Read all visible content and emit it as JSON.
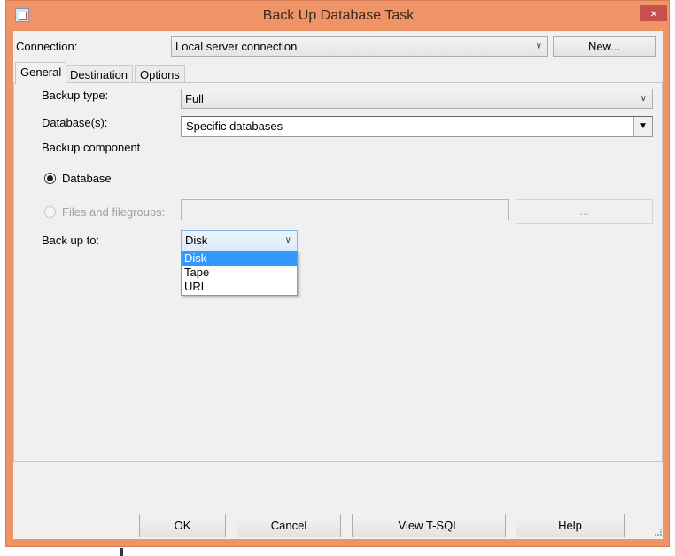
{
  "window": {
    "title": "Back Up Database Task",
    "close": "×"
  },
  "connection": {
    "label": "Connection:",
    "value": "Local server connection",
    "new_button": "New..."
  },
  "tabs": [
    {
      "label": "General",
      "active": true
    },
    {
      "label": "Destination"
    },
    {
      "label": "Options"
    }
  ],
  "general": {
    "backup_type": {
      "label": "Backup type:",
      "value": "Full"
    },
    "databases": {
      "label": "Database(s):",
      "value": "Specific databases"
    },
    "backup_component": {
      "label": "Backup component"
    },
    "radio_database": {
      "label": "Database",
      "checked": true
    },
    "radio_files": {
      "label": "Files and filegroups:",
      "enabled": false,
      "browse": "..."
    },
    "back_up_to": {
      "label": "Back up to:",
      "value": "Disk",
      "options": [
        "Disk",
        "Tape",
        "URL"
      ],
      "selected": "Disk"
    }
  },
  "buttons": {
    "ok": "OK",
    "cancel": "Cancel",
    "view_tsql": "View T-SQL",
    "help": "Help"
  },
  "colors": {
    "frame": "#EE9466",
    "close": "#C7504A",
    "selection": "#3399FF"
  }
}
